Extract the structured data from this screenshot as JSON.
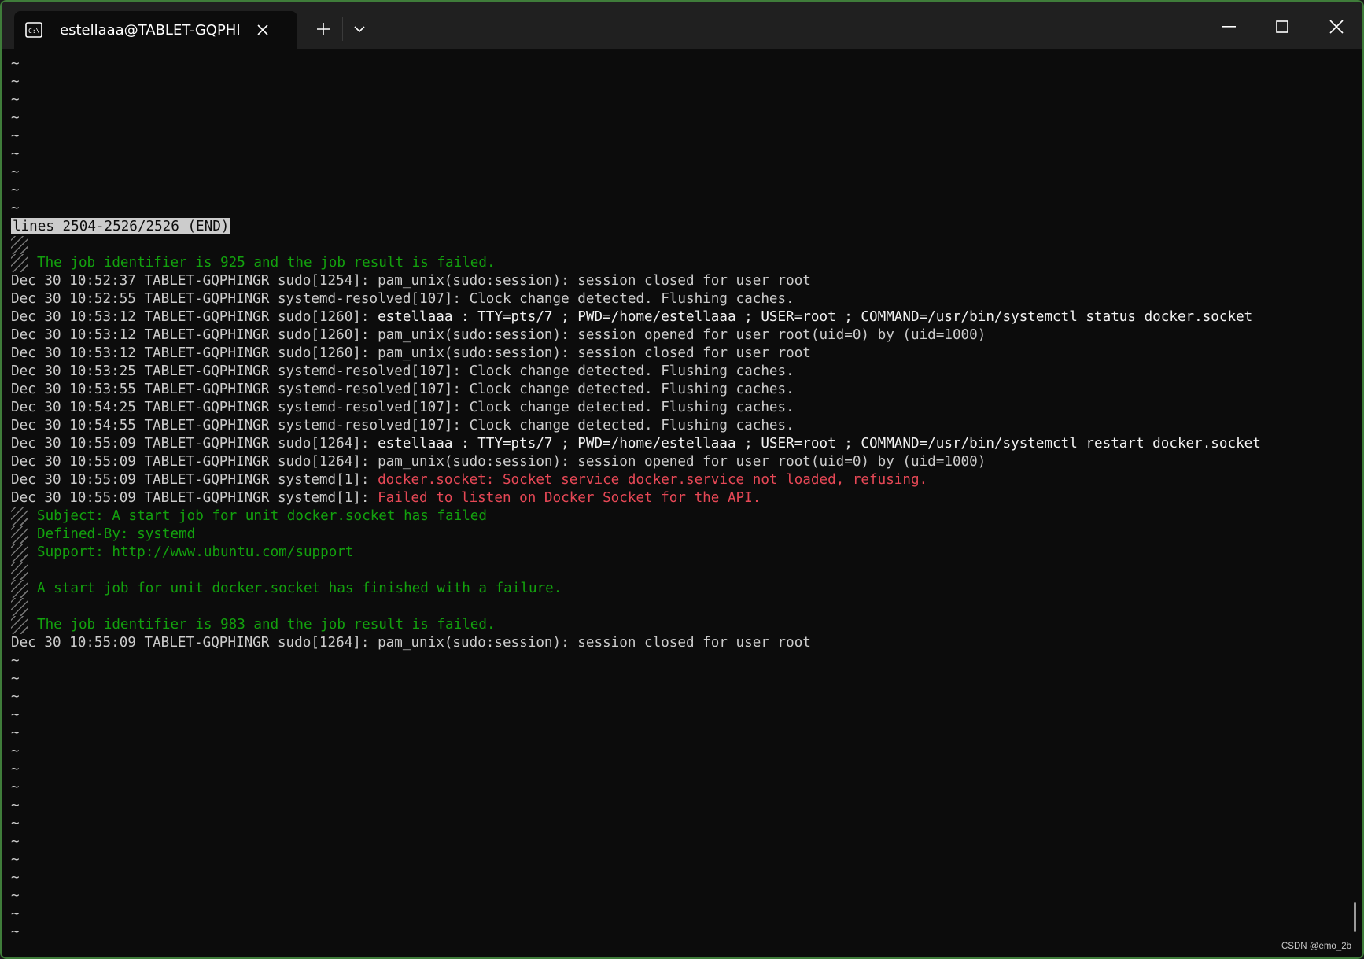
{
  "tab": {
    "title": "estellaaa@TABLET-GQPHINGR",
    "icon": "terminal-icon"
  },
  "toolbar": {
    "new_tab_icon": "plus-icon",
    "dropdown_icon": "chevron-down-icon"
  },
  "window_controls": [
    "minimize-icon",
    "maximize-icon",
    "close-icon"
  ],
  "terminal": {
    "tilde_top_count": 9,
    "status_line": "lines 2504-2526/2526 (END)",
    "lines": [
      {
        "kind": "bar"
      },
      {
        "kind": "green_bar",
        "text": "The job identifier is 925 and the job result is failed."
      },
      {
        "kind": "plain",
        "prefix": "Dec 30 10:52:37 TABLET-GQPHINGR sudo[1254]: ",
        "text": "pam_unix(sudo:session): session closed for user root"
      },
      {
        "kind": "plain",
        "prefix": "Dec 30 10:52:55 TABLET-GQPHINGR systemd-resolved[107]: ",
        "text": "Clock change detected. Flushing caches."
      },
      {
        "kind": "bold",
        "prefix": "Dec 30 10:53:12 TABLET-GQPHINGR sudo[1260]: ",
        "text": "estellaaa : TTY=pts/7 ; PWD=/home/estellaaa ; USER=root ; COMMAND=/usr/bin/systemctl status docker.socket"
      },
      {
        "kind": "plain",
        "prefix": "Dec 30 10:53:12 TABLET-GQPHINGR sudo[1260]: ",
        "text": "pam_unix(sudo:session): session opened for user root(uid=0) by (uid=1000)"
      },
      {
        "kind": "plain",
        "prefix": "Dec 30 10:53:12 TABLET-GQPHINGR sudo[1260]: ",
        "text": "pam_unix(sudo:session): session closed for user root"
      },
      {
        "kind": "plain",
        "prefix": "Dec 30 10:53:25 TABLET-GQPHINGR systemd-resolved[107]: ",
        "text": "Clock change detected. Flushing caches."
      },
      {
        "kind": "plain",
        "prefix": "Dec 30 10:53:55 TABLET-GQPHINGR systemd-resolved[107]: ",
        "text": "Clock change detected. Flushing caches."
      },
      {
        "kind": "plain",
        "prefix": "Dec 30 10:54:25 TABLET-GQPHINGR systemd-resolved[107]: ",
        "text": "Clock change detected. Flushing caches."
      },
      {
        "kind": "plain",
        "prefix": "Dec 30 10:54:55 TABLET-GQPHINGR systemd-resolved[107]: ",
        "text": "Clock change detected. Flushing caches."
      },
      {
        "kind": "bold",
        "prefix": "Dec 30 10:55:09 TABLET-GQPHINGR sudo[1264]: ",
        "text": "estellaaa : TTY=pts/7 ; PWD=/home/estellaaa ; USER=root ; COMMAND=/usr/bin/systemctl restart docker.socket"
      },
      {
        "kind": "plain",
        "prefix": "Dec 30 10:55:09 TABLET-GQPHINGR sudo[1264]: ",
        "text": "pam_unix(sudo:session): session opened for user root(uid=0) by (uid=1000)"
      },
      {
        "kind": "red",
        "prefix": "Dec 30 10:55:09 TABLET-GQPHINGR systemd[1]: ",
        "text": "docker.socket: Socket service docker.service not loaded, refusing."
      },
      {
        "kind": "red",
        "prefix": "Dec 30 10:55:09 TABLET-GQPHINGR systemd[1]: ",
        "text": "Failed to listen on Docker Socket for the API."
      },
      {
        "kind": "green_bar",
        "text": "Subject: A start job for unit docker.socket has failed"
      },
      {
        "kind": "green_bar",
        "text": "Defined-By: systemd"
      },
      {
        "kind": "green_bar",
        "text": "Support: http://www.ubuntu.com/support"
      },
      {
        "kind": "bar"
      },
      {
        "kind": "green_bar",
        "text": "A start job for unit docker.socket has finished with a failure."
      },
      {
        "kind": "bar"
      },
      {
        "kind": "green_bar",
        "text": "The job identifier is 983 and the job result is failed."
      },
      {
        "kind": "plain",
        "prefix": "Dec 30 10:55:09 TABLET-GQPHINGR sudo[1264]: ",
        "text": "pam_unix(sudo:session): session closed for user root"
      }
    ],
    "tilde_bottom_count": 16,
    "tilde_char": "~"
  },
  "watermark": "CSDN @emo_2b",
  "colors": {
    "background": "#0c0c0c",
    "titlebar": "#202020",
    "green": "#13a10e",
    "red": "#e74856",
    "text": "#cccccc",
    "window_border": "#3f7d3a"
  }
}
